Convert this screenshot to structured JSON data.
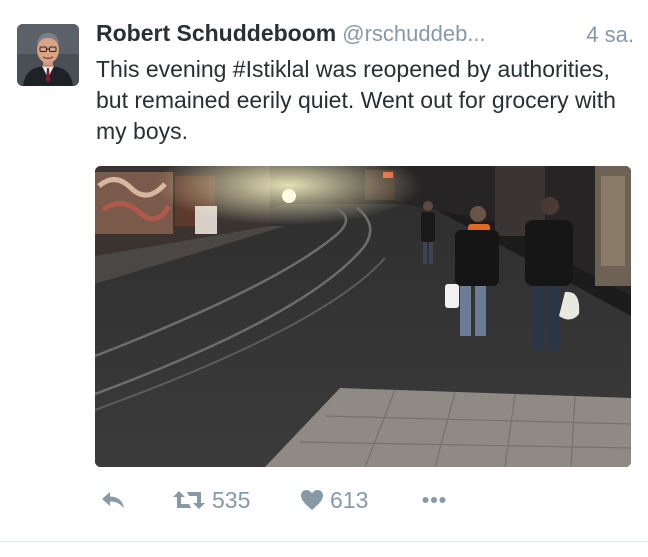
{
  "tweet": {
    "author": {
      "name": "Robert Schuddeboom",
      "handle": "@rschuddeb...",
      "avatar_icon": "profile-photo"
    },
    "timestamp": "4 sa.",
    "text": "This evening #Istiklal was reopened by authorities, but remained eerily quiet. Went out for grocery with my boys.",
    "media": {
      "type": "photo",
      "icon": "street-night-photo"
    },
    "actions": {
      "reply_icon": "reply-icon",
      "retweet_icon": "retweet-icon",
      "retweet_count": "535",
      "like_icon": "heart-icon",
      "like_count": "613",
      "more_icon": "more-icon"
    }
  },
  "colors": {
    "text": "#292f33",
    "muted": "#8899a6",
    "border": "#e1e8ed"
  }
}
